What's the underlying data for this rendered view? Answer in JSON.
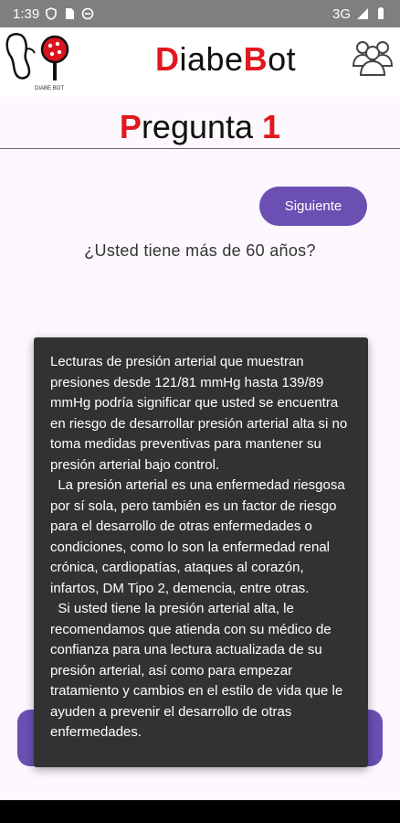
{
  "status": {
    "time": "1:39",
    "network": "3G"
  },
  "app_bar": {
    "brand_prefix_1": "D",
    "brand_part_1": "iabe",
    "brand_prefix_2": "B",
    "brand_part_2": "ot",
    "logo_caption": "DIABE BOT"
  },
  "question": {
    "title_word": "regunta ",
    "title_initial": "P",
    "title_number": "1",
    "text": "¿Usted tiene más de 60 años?"
  },
  "buttons": {
    "next_label": "Siguiente"
  },
  "toast": {
    "text": "Lecturas de presión arterial que muestran presiones desde 121/81 mmHg hasta 139/89 mmHg podría significar que usted se encuentra en riesgo de desarrollar presión arterial alta si no toma medidas preventivas para mantener su presión arterial bajo control.\n  La presión arterial es una enfermedad riesgosa por sí sola, pero también es un factor de riesgo para el desarrollo de otras enfermedades o condiciones, como lo son la enfermedad renal crónica, cardiopatías, ataques al corazón, infartos, DM Tipo 2, demencia, entre otras.\n  Si usted tiene la presión arterial alta, le recomendamos que atienda con su médico de confianza para una lectura actualizada de su presión arterial, así como para empezar tratamiento y cambios en el estilo de vida que le ayuden a prevenir el desarrollo de otras enfermedades."
  },
  "colors": {
    "accent": "#6b4fb3",
    "brand_red": "#e1181d",
    "toast_bg": "#323232"
  },
  "icons": [
    "shield-icon",
    "sim-icon",
    "sync-icon",
    "signal-icon",
    "battery-icon",
    "kidney-logo-icon",
    "users-icon"
  ]
}
